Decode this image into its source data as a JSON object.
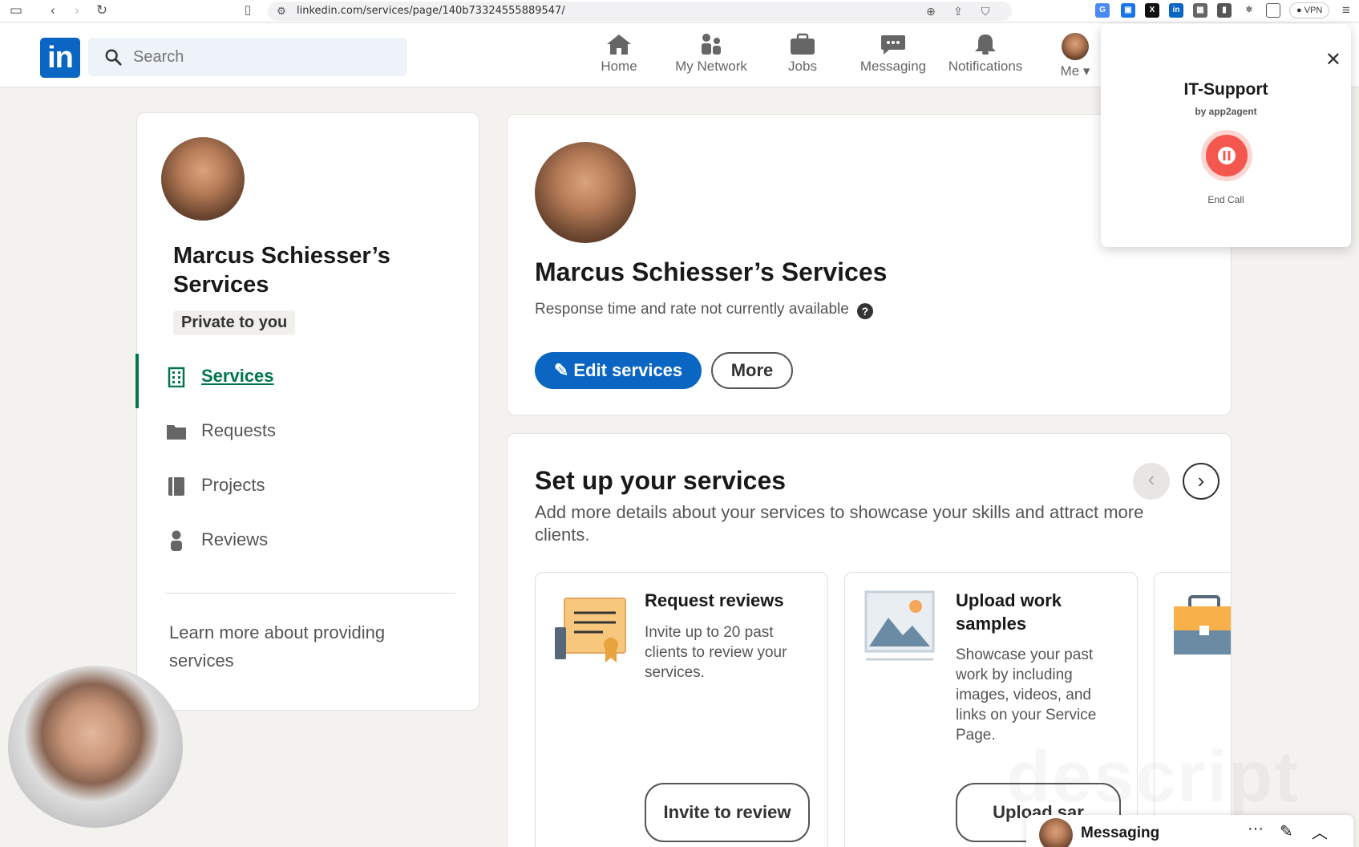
{
  "browser": {
    "url": "linkedin.com/services/page/140b73324555889547/",
    "vpn_label": "VPN"
  },
  "nav": {
    "logo": "in",
    "search_placeholder": "Search",
    "items": [
      {
        "label": "Home",
        "icon": "home-icon"
      },
      {
        "label": "My Network",
        "icon": "network-icon"
      },
      {
        "label": "Jobs",
        "icon": "briefcase-icon"
      },
      {
        "label": "Messaging",
        "icon": "chat-icon"
      },
      {
        "label": "Notifications",
        "icon": "bell-icon"
      },
      {
        "label": "Me",
        "icon": "avatar"
      }
    ]
  },
  "sidebar": {
    "title": "Marcus Schiesser’s Services",
    "badge": "Private to you",
    "menu": [
      {
        "label": "Services",
        "icon": "building-icon",
        "active": true
      },
      {
        "label": "Requests",
        "icon": "folder-icon",
        "active": false
      },
      {
        "label": "Projects",
        "icon": "book-icon",
        "active": false
      },
      {
        "label": "Reviews",
        "icon": "person-icon",
        "active": false
      }
    ],
    "learn_more": "Learn more about providing services"
  },
  "profile": {
    "title": "Marcus Schiesser’s Services",
    "response": "Response time and rate not currently available",
    "edit_label": "Edit services",
    "more_label": "More"
  },
  "setup": {
    "title": "Set up your services",
    "description": "Add more details about your services to showcase your skills and attract more clients.",
    "cards": [
      {
        "title": "Request reviews",
        "description": "Invite up to 20 past clients to review your services.",
        "button": "Invite to review"
      },
      {
        "title": "Upload work samples",
        "description": "Showcase your past work by including images, videos, and links on your Service Page.",
        "button": "Upload sar"
      }
    ]
  },
  "call_widget": {
    "title": "IT-Support",
    "by": "by app2agent",
    "end_label": "End Call"
  },
  "messaging": {
    "label": "Messaging"
  },
  "watermark": "descript",
  "colors": {
    "brand": "#0a66c2",
    "active": "#01754f",
    "end_call": "#f3574d"
  }
}
